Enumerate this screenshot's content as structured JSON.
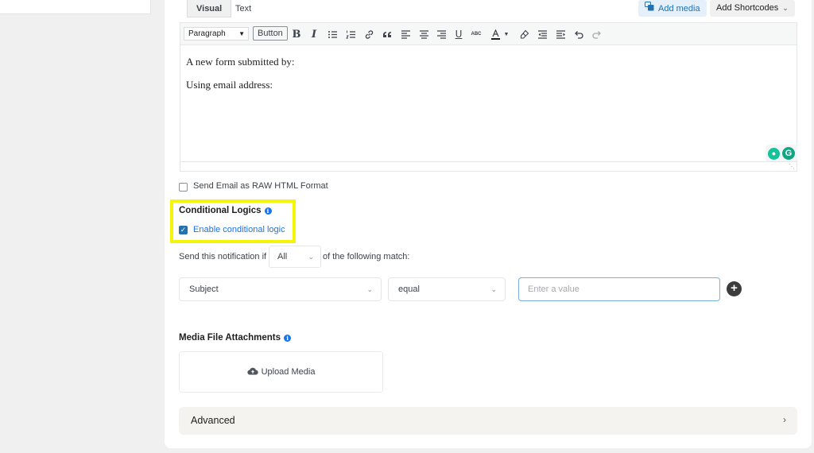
{
  "editor": {
    "tabs": [
      {
        "label": "Visual",
        "active": true
      },
      {
        "label": "Text",
        "active": false
      }
    ],
    "add_media_label": "Add media",
    "add_shortcodes_label": "Add Shortcodes",
    "toolbar": {
      "format_select": "Paragraph",
      "button_label": "Button",
      "icons": [
        "bold-icon",
        "italic-icon",
        "bullet-list-icon",
        "numbered-list-icon",
        "link-icon",
        "blockquote-icon",
        "align-left-icon",
        "align-center-icon",
        "align-right-icon",
        "underline-icon",
        "strikethrough-icon",
        "text-color-icon",
        "clear-formatting-icon",
        "outdent-icon",
        "indent-icon",
        "undo-icon",
        "redo-icon"
      ]
    },
    "content_lines": [
      "A new form submitted by:",
      "Using email address:"
    ]
  },
  "raw_html_option": {
    "label": "Send Email as RAW HTML Format",
    "checked": false
  },
  "conditional": {
    "title": "Conditional Logics",
    "enable_label": "Enable conditional logic",
    "enabled": true,
    "send_prefix": "Send this notification if",
    "match_value": "All",
    "send_suffix": "of the following match:",
    "field_select": "Subject",
    "operator_select": "equal",
    "value_placeholder": "Enter a value"
  },
  "attachments": {
    "title": "Media File Attachments",
    "upload_label": "Upload Media"
  },
  "advanced": {
    "label": "Advanced"
  },
  "colors": {
    "accent": "#2271b1",
    "link_blue": "#1a73e8",
    "highlight": "#f5f50a"
  }
}
